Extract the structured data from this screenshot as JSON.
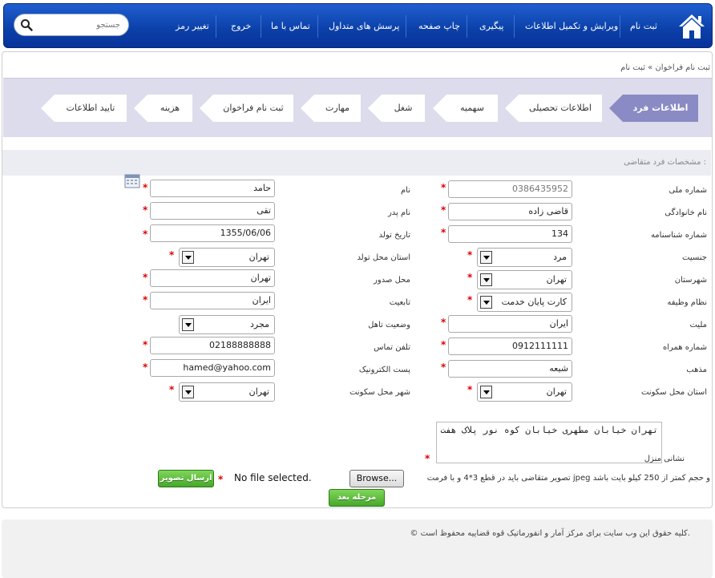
{
  "header": {
    "search_placeholder": "جستجو",
    "nav": [
      "ثبت نام",
      "ویرایش و تکمیل اطلاعات",
      "پیگیری",
      "چاپ صفحه",
      "پرسش های متداول",
      "تماس با ما",
      "خروج",
      "تغییر رمز"
    ]
  },
  "breadcrumb": "ثبت نام فراخوان  »  ثبت نام",
  "wizard": {
    "steps": [
      "اطلاعات فرد",
      "اطلاعات تحصیلی",
      "سهمیه",
      "شغل",
      "مهارت",
      "ثبت نام فراخوان",
      "هزینه",
      "تایید اطلاعات"
    ]
  },
  "section_title": "مشخصات فرد متقاضی :",
  "form": {
    "national_id": {
      "label": "شماره ملی",
      "value": "0386435952"
    },
    "first_name": {
      "label": "نام",
      "value": "حامد"
    },
    "last_name": {
      "label": "نام خانوادگی",
      "value": "قاضی زاده"
    },
    "father_name": {
      "label": "نام پدر",
      "value": "تقی"
    },
    "id_number": {
      "label": "شماره شناسنامه",
      "value": "134"
    },
    "birth_date": {
      "label": "تاریخ تولد",
      "value": "1355/06/06"
    },
    "gender": {
      "label": "جنسیت",
      "value": "مرد"
    },
    "birth_province": {
      "label": "استان محل تولد",
      "value": "تهران"
    },
    "county": {
      "label": "شهرستان",
      "value": "تهران"
    },
    "issue_place": {
      "label": "محل صدور",
      "value": "تهران"
    },
    "military": {
      "label": "نظام وظیفه",
      "value": "کارت پایان خدمت"
    },
    "citizenship": {
      "label": "تابعیت",
      "value": "ایران"
    },
    "nationality": {
      "label": "ملیت",
      "value": "ایران"
    },
    "marital": {
      "label": "وضعیت تاهل",
      "value": "مجرد"
    },
    "mobile": {
      "label": "شماره همراه",
      "value": "0912111111"
    },
    "phone": {
      "label": "تلفن تماس",
      "value": "02188888888"
    },
    "religion": {
      "label": "مذهب",
      "value": "شیعه"
    },
    "email": {
      "label": "پست الکترونیک",
      "value": "hamed@yahoo.com"
    },
    "res_province": {
      "label": "استان محل سکونت",
      "value": "تهران"
    },
    "res_city": {
      "label": "شهر محل سکونت",
      "value": "تهران"
    },
    "address": {
      "label": "نشانی منزل",
      "value": "تهران خیابان مطهری خیابان کوه نور پلاک هفت"
    },
    "photo_note": "تصویر متقاضی باید در قطع 3*4 و با فرمت jpeg و حجم کمتر از 250 کیلو بایت باشد",
    "browse_label": "Browse...",
    "file_status": "No file selected.",
    "upload_button": "ارسال تصویر",
    "next_button": "مرحله بعد"
  },
  "footer": "© کلیه حقوق این وب سایت برای مرکز آمار و انفورماتیک قوه قضاییه محفوظ است."
}
